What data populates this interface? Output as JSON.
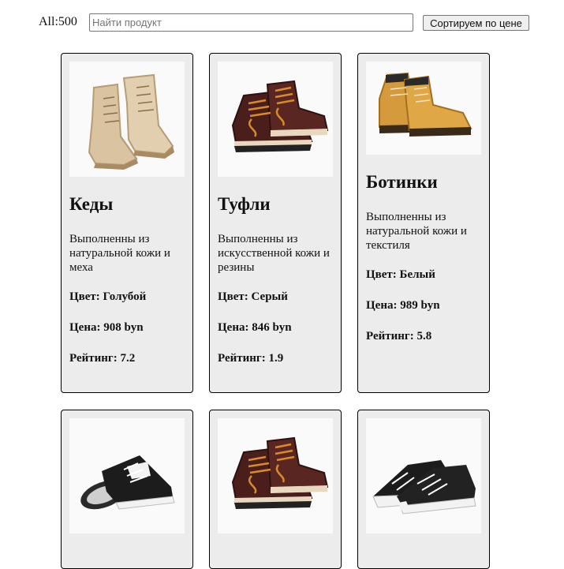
{
  "header": {
    "count_label": "All:500",
    "search_placeholder": "Найти продукт",
    "search_value": "",
    "sort_button": "Сортируем по цене"
  },
  "products": [
    {
      "name": "Кеды",
      "desc": "Выполненны из натуральной кожи и меха",
      "color": "Цвет: Голубой",
      "price": "Цена: 908 byn",
      "rating": "Рейтинг: 7.2",
      "image": "desert-boots-icon"
    },
    {
      "name": "Туфли",
      "desc": "Выполненны из искусственной кожи и резины",
      "color": "Цвет: Серый",
      "price": "Цена: 846 byn",
      "rating": "Рейтинг: 1.9",
      "image": "brown-boots-icon"
    },
    {
      "name": "Ботинки",
      "desc": "Выполненны из натуральной кожи и текстиля",
      "color": "Цвет: Белый",
      "price": "Цена: 989 byn",
      "rating": "Рейтинг: 5.8",
      "image": "yellow-boots-icon"
    },
    {
      "image": "black-sneakers-icon"
    },
    {
      "image": "brown-boots-icon"
    },
    {
      "image": "black-sneakers-pair-icon"
    }
  ]
}
